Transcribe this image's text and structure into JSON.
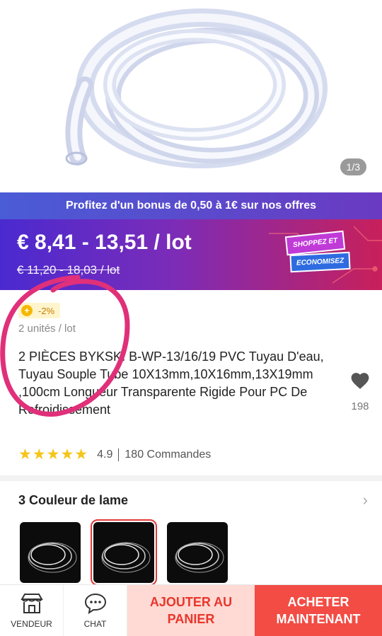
{
  "gallery": {
    "counter": "1/3"
  },
  "promo": {
    "text": "Profitez d'un bonus de 0,50 à 1€ sur nos offres"
  },
  "price": {
    "current": "€ 8,41 - 13,51 / lot",
    "original": "€ 11,20 - 18,03 / lot",
    "badge_top": "SHOPPEZ ET",
    "badge_bottom": "ECONOMISEZ"
  },
  "product": {
    "discount_badge": "-2%",
    "units": "2 unités / lot",
    "title": "2 PIÈCES BYKSKI B-WP-13/16/19 PVC Tuyau D'eau, Tuyau Souple Tube 10X13mm,10X16mm,13X19mm ,100cm Longueur Transparente Rigide Pour PC De Refroidissement",
    "wishlist_count": "198",
    "rating": "4.9",
    "orders": "180 Commandes",
    "stars": "★★★★★"
  },
  "variants": {
    "label": "3 Couleur de lame",
    "chevron": "›",
    "selected_index": 1
  },
  "bottom_bar": {
    "vendor_label": "VENDEUR",
    "chat_label": "CHAT",
    "cart_label": "AJOUTER AU PANIER",
    "buy_label": "ACHETER MAINTENANT"
  },
  "colors": {
    "accent_red": "#f24c44",
    "cart_bg": "#ffd9d4",
    "star": "#f5c518",
    "annotation": "#e0307a"
  }
}
